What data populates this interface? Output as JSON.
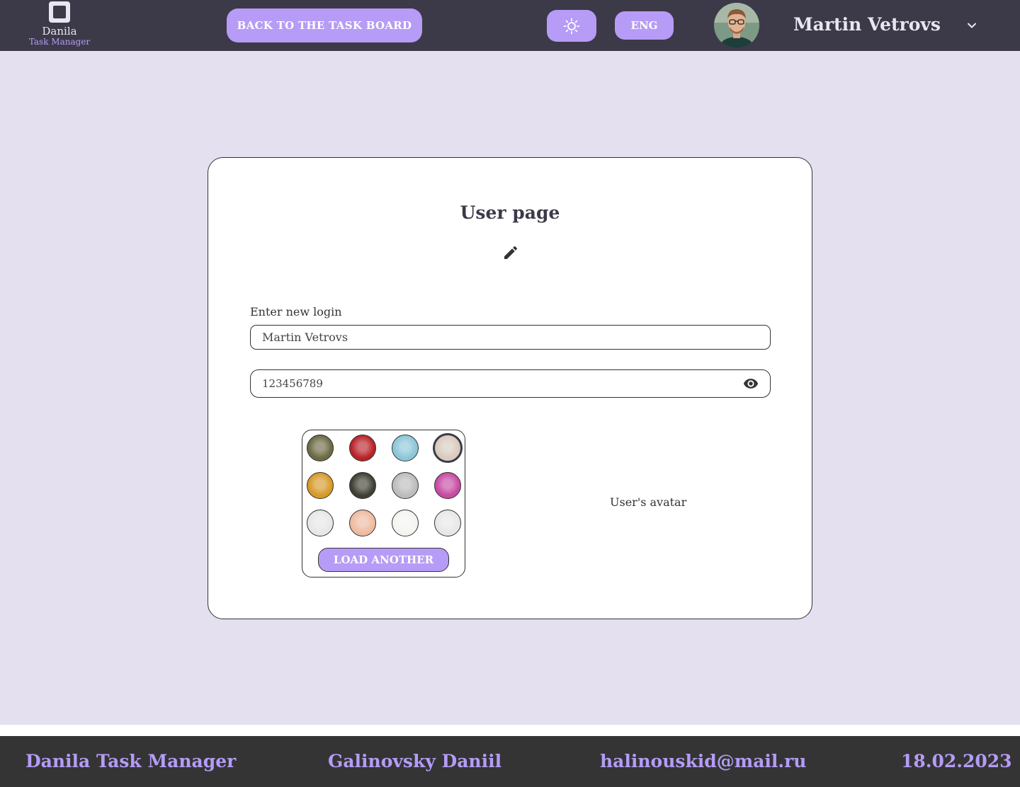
{
  "header": {
    "logo_name": "Danila",
    "logo_subtitle": "Task Manager",
    "back_button": "BACK TO THE TASK BOARD",
    "language": "ENG",
    "user_name": "Martin Vetrovs",
    "theme_icon": "sun-icon",
    "dropdown_icon": "chevron-down-icon"
  },
  "card": {
    "title": "User page",
    "edit_icon": "pencil-icon",
    "login_label": "Enter new login",
    "login_value": "Martin Vetrovs",
    "password_value": "123456789",
    "password_toggle_icon": "eye-icon",
    "avatar_options": [
      {
        "id": "hare",
        "color": "#6b6a44"
      },
      {
        "id": "parrot",
        "color": "#b8222a"
      },
      {
        "id": "whale",
        "color": "#8cc6d8"
      },
      {
        "id": "dog",
        "color": "#d8cbbd",
        "selected": true
      },
      {
        "id": "neon-city",
        "color": "#d59a2a"
      },
      {
        "id": "bear",
        "color": "#3f3f34"
      },
      {
        "id": "sketch",
        "color": "#bcbcbc"
      },
      {
        "id": "rainbow",
        "color": "#c74aa2"
      },
      {
        "id": "branch",
        "color": "#e7e7e7"
      },
      {
        "id": "flower",
        "color": "#efbaa0"
      },
      {
        "id": "leaves",
        "color": "#f4f5f1"
      },
      {
        "id": "sprig",
        "color": "#e6e8e6"
      }
    ],
    "load_button": "LOAD ANOTHER",
    "avatar_caption": "User's avatar"
  },
  "footer": {
    "app_name": "Danila Task Manager",
    "author": "Galinovsky Daniil",
    "email": "halinouskid@mail.ru",
    "date": "18.02.2023"
  },
  "colors": {
    "header_bg": "#3c3a48",
    "accent": "#b69cf6",
    "page_bg": "#e4e0f0",
    "footer_bg": "#343434"
  }
}
